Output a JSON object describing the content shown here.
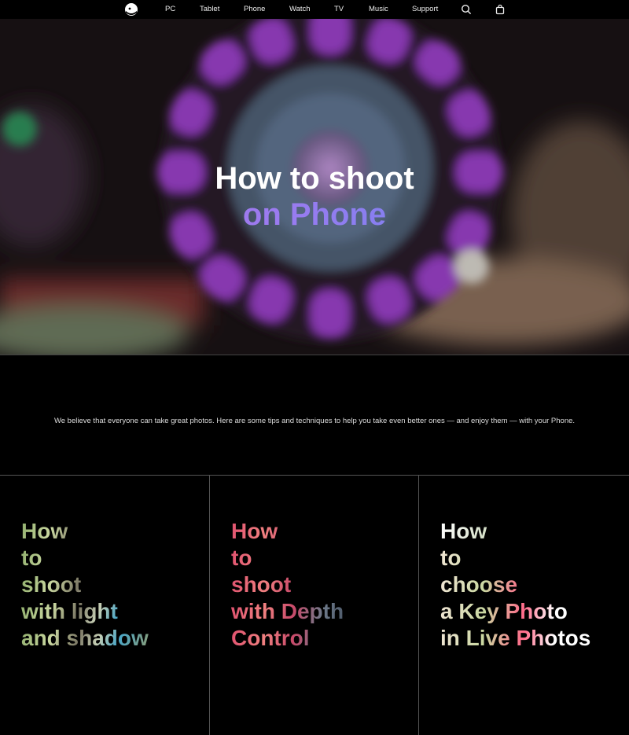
{
  "nav": {
    "items": [
      "PC",
      "Tablet",
      "Phone",
      "Watch",
      "TV",
      "Music",
      "Support"
    ],
    "icons": [
      "logo-icon",
      "search-icon",
      "bag-icon"
    ]
  },
  "hero": {
    "title_line1": "How to shoot",
    "title_line2": "on Phone"
  },
  "intro": "We believe that everyone can take great photos. Here are some tips and techniques to help you take even better ones — and enjoy them — with your Phone.",
  "cards": [
    {
      "lines": [
        "How",
        "to",
        "shoot",
        "with light",
        "and shadow"
      ]
    },
    {
      "lines": [
        "How",
        "to",
        "shoot",
        "with Depth",
        "Control"
      ]
    },
    {
      "lines": [
        "How",
        "to",
        "choose",
        "a Key Photo",
        "in Live Photos"
      ]
    }
  ]
}
